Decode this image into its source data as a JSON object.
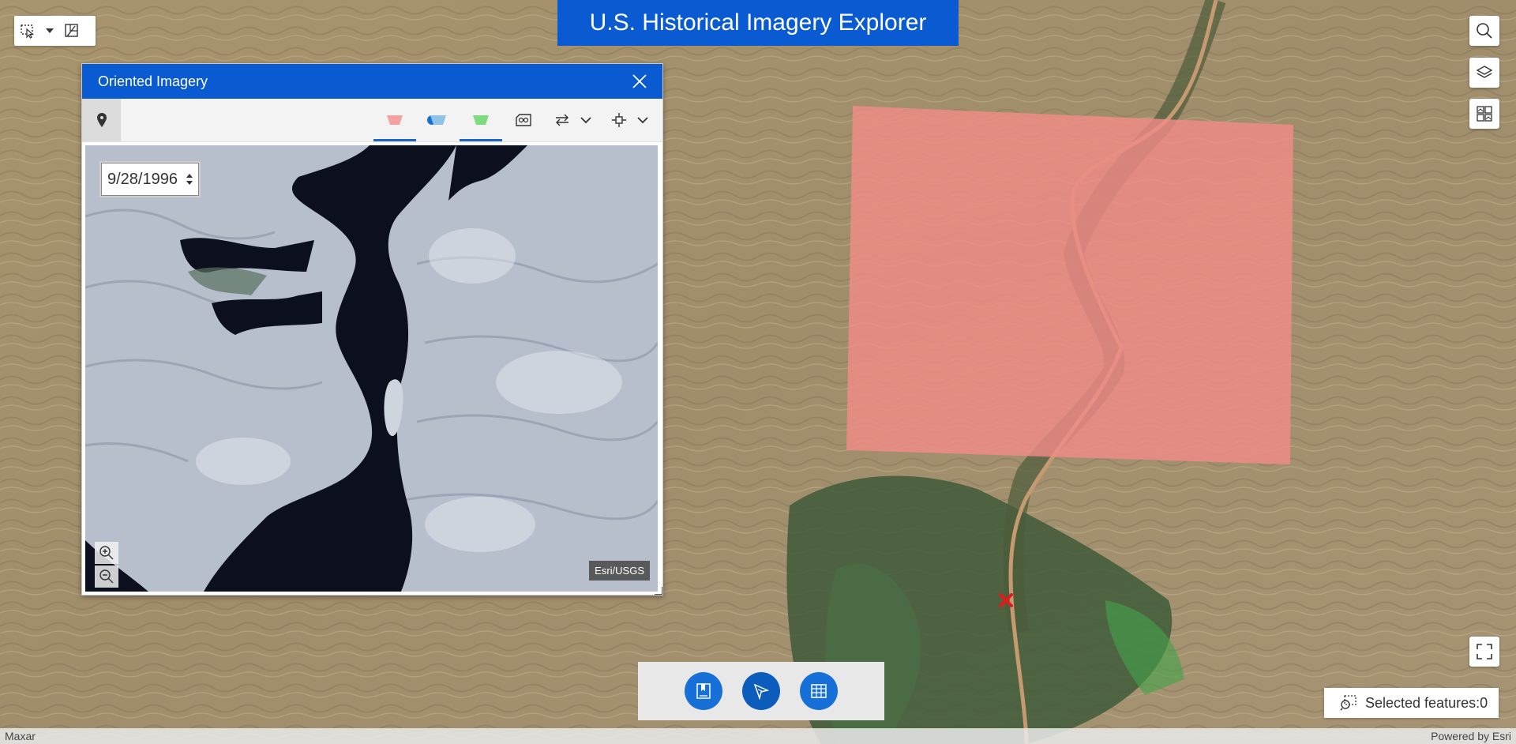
{
  "app": {
    "title": "U.S. Historical Imagery Explorer"
  },
  "select_tools": {
    "select_icon": "select-pointer-icon",
    "dropdown_icon": "chevron-down-icon",
    "clear_icon": "clear-selection-icon"
  },
  "right_toolbar": {
    "search_icon": "search-icon",
    "layers_icon": "layers-icon",
    "basemap_icon": "basemap-gallery-icon",
    "fullscreen_icon": "fullscreen-icon"
  },
  "oriented_imagery": {
    "title": "Oriented Imagery",
    "date": "9/28/1996",
    "attribution": "Esri/USGS",
    "toolbar": {
      "point_color": "#1b6fd1",
      "footprint_colors": [
        "#f4a1a1",
        "#8ec3e6",
        "#7edb7e"
      ]
    }
  },
  "map": {
    "footprint_color": "#f08b87",
    "marker_color": "#e01b1b"
  },
  "action_bar": {
    "buttons": [
      "bookmarks-icon",
      "sketch-icon",
      "table-icon"
    ]
  },
  "selected_features": {
    "label": "Selected features:0"
  },
  "attribution": {
    "left": "Maxar",
    "right": "Powered by Esri"
  }
}
